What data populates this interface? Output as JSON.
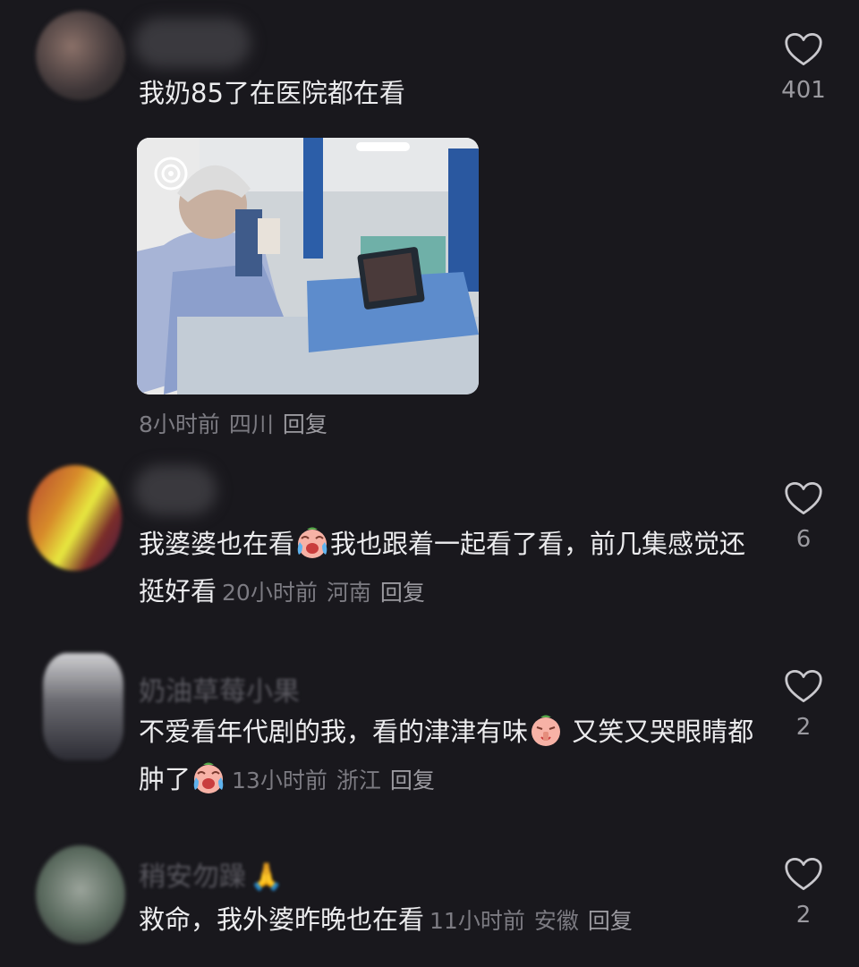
{
  "comments": [
    {
      "text": "我奶85了在医院都在看",
      "time": "8小时前",
      "location": "四川",
      "reply_label": "回复",
      "likes": "401"
    },
    {
      "text_parts": [
        "我婆婆也在看",
        "我也跟着一起看了看，前几集感觉还挺好看"
      ],
      "time": "20小时前",
      "location": "河南",
      "reply_label": "回复",
      "likes": "6"
    },
    {
      "username": "奶油草莓小果",
      "text_parts": [
        "不爱看年代剧的我，看的津津有味",
        " 又笑又哭眼睛都肿了"
      ],
      "time": "13小时前",
      "location": "浙江",
      "reply_label": "回复",
      "likes": "2"
    },
    {
      "username": "稍安勿躁",
      "username_emoji": "🙏",
      "text": "救命，我外婆昨晚也在看",
      "time": "11小时前",
      "location": "安徽",
      "reply_label": "回复",
      "likes": "2"
    }
  ],
  "colors": {
    "background": "#19181d",
    "text": "#ececee",
    "meta": "#7c7b82",
    "icon": "#c9c8cd"
  },
  "icons": [
    "heart-outline-icon",
    "crying-laughing-emoji",
    "praying-hands-emoji"
  ]
}
